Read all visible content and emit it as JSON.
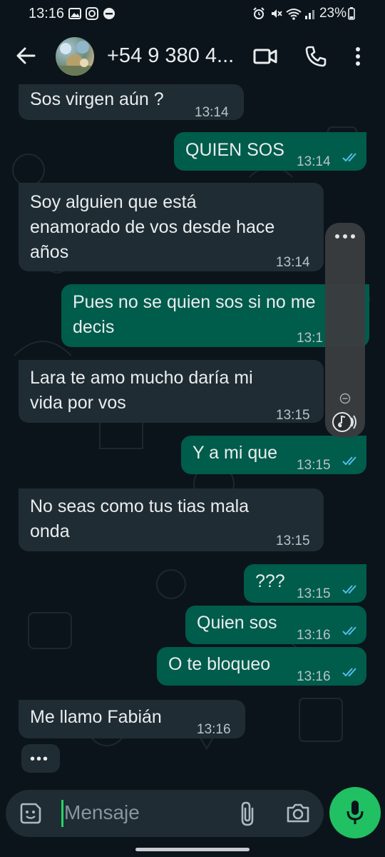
{
  "status_bar": {
    "time": "13:16",
    "battery": "23%"
  },
  "header": {
    "contact_name": "+54 9 380 4...",
    "icons": [
      "back-arrow-icon",
      "video-call-icon",
      "phone-icon",
      "more-vert-icon"
    ]
  },
  "messages": [
    {
      "dir": "in",
      "lines": "Sos virgen aún ?",
      "time": "13:14"
    },
    {
      "dir": "out",
      "lines": "QUIEN SOS",
      "time": "13:14",
      "read": true
    },
    {
      "dir": "in",
      "lines": "Soy alguien que está\nenamorado de vos desde hace\naños",
      "time": "13:14"
    },
    {
      "dir": "out",
      "lines": "Pues no se quien sos si no me\ndecis",
      "time": "13:1",
      "read": true
    },
    {
      "dir": "in",
      "lines": "Lara te amo mucho daría mi\nvida por vos",
      "time": "13:15"
    },
    {
      "dir": "out",
      "lines": "Y a mi que",
      "time": "13:15",
      "read": true
    },
    {
      "dir": "in",
      "lines": "No seas como tus tias mala\nonda",
      "time": "13:15"
    },
    {
      "dir": "out",
      "lines": "???",
      "time": "13:15",
      "read": true
    },
    {
      "dir": "out",
      "lines": "Quien sos",
      "time": "13:16",
      "read": true
    },
    {
      "dir": "out",
      "lines": "O te bloqueo",
      "time": "13:16",
      "read": true
    },
    {
      "dir": "in",
      "lines": "Me llamo Fabián",
      "time": "13:16"
    }
  ],
  "typing_indicator": "•••",
  "input": {
    "placeholder": "Mensaje"
  },
  "colors": {
    "background": "#0b141a",
    "incoming_bubble": "#202c33",
    "outgoing_bubble": "#005c4b",
    "accent": "#21c063",
    "read_ticks": "#53bdeb"
  }
}
